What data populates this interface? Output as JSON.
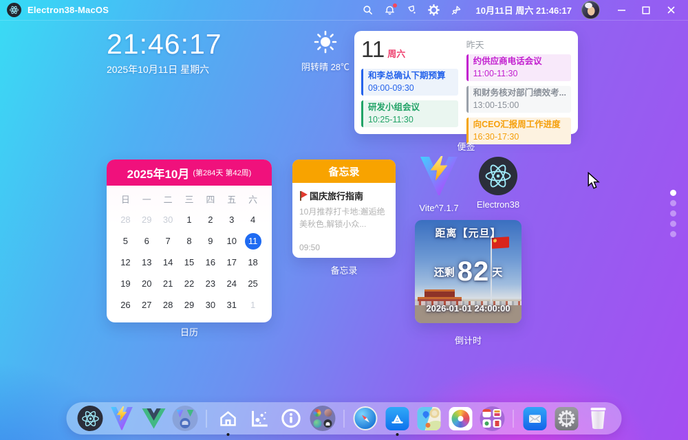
{
  "titlebar": {
    "app_title": "Electron38-MacOS",
    "datetime": "10月11日 周六 21:46:17",
    "icons": [
      "search",
      "notifications",
      "theme-bucket",
      "settings",
      "pin"
    ],
    "window_controls": [
      "minimize",
      "maximize",
      "close"
    ]
  },
  "clock": {
    "time": "21:46:17",
    "date": "2025年10月11日 星期六"
  },
  "weather": {
    "condition": "阴转晴 28℃",
    "icon": "sun"
  },
  "sticky": {
    "label": "便签",
    "day": "11",
    "weekday": "周六",
    "yesterday_label": "昨天",
    "today_events": [
      {
        "title": "和李总确认下期预算",
        "time": "09:00-09:30",
        "color": "blue"
      },
      {
        "title": "研发小组会议",
        "time": "10:25-11:30",
        "color": "green"
      }
    ],
    "yesterday_events": [
      {
        "title": "约供应商电话会议",
        "time": "11:00-11:30",
        "color": "magenta"
      },
      {
        "title": "和财务核对部门绩效考...",
        "time": "13:00-15:00",
        "color": "gray"
      },
      {
        "title": "向CEO汇报周工作进度",
        "time": "16:30-17:30",
        "color": "orange"
      }
    ]
  },
  "calendar": {
    "label": "日历",
    "title": "2025年10月",
    "subtitle": "(第284天 第42周)",
    "weekdays": [
      "日",
      "一",
      "二",
      "三",
      "四",
      "五",
      "六"
    ],
    "weeks": [
      [
        {
          "t": "28",
          "muted": true
        },
        {
          "t": "29",
          "muted": true
        },
        {
          "t": "30",
          "muted": true
        },
        {
          "t": "1"
        },
        {
          "t": "2"
        },
        {
          "t": "3"
        },
        {
          "t": "4"
        }
      ],
      [
        {
          "t": "5"
        },
        {
          "t": "6"
        },
        {
          "t": "7"
        },
        {
          "t": "8"
        },
        {
          "t": "9"
        },
        {
          "t": "10"
        },
        {
          "t": "11",
          "selected": true
        }
      ],
      [
        {
          "t": "12"
        },
        {
          "t": "13"
        },
        {
          "t": "14"
        },
        {
          "t": "15"
        },
        {
          "t": "16"
        },
        {
          "t": "17"
        },
        {
          "t": "18"
        }
      ],
      [
        {
          "t": "19"
        },
        {
          "t": "20"
        },
        {
          "t": "21"
        },
        {
          "t": "22"
        },
        {
          "t": "23"
        },
        {
          "t": "24"
        },
        {
          "t": "25"
        }
      ],
      [
        {
          "t": "26"
        },
        {
          "t": "27"
        },
        {
          "t": "28"
        },
        {
          "t": "29"
        },
        {
          "t": "30"
        },
        {
          "t": "31"
        },
        {
          "t": "1",
          "muted": true
        }
      ]
    ],
    "selected_day": "11"
  },
  "memo": {
    "label": "备忘录",
    "header": "备忘录",
    "title": "国庆旅行指南",
    "body": "10月推荐打卡地:邂逅绝美秋色,解锁小众...",
    "time": "09:50"
  },
  "apps": {
    "vite": {
      "label": "Vite^7.1.7"
    },
    "electron": {
      "label": "Electron38"
    }
  },
  "countdown": {
    "label": "倒计时",
    "title": "距离【元旦】",
    "prefix": "还剩",
    "days": "82",
    "suffix": "天",
    "target": "2026-01-01 24:00:00"
  },
  "pagination": {
    "total": 5,
    "active_index": 0
  },
  "dock": {
    "apps": [
      "electron",
      "vite",
      "vue",
      "dev-group",
      "home",
      "chart",
      "info",
      "web-group",
      "safari",
      "app-store",
      "maps",
      "photos",
      "widgets",
      "mail",
      "settings",
      "trash"
    ],
    "running": [
      "home",
      "app-store"
    ]
  },
  "colors": {
    "calendar_header": "#F0117C",
    "memo_header": "#F8A300",
    "selected_day": "#1F6BF2",
    "accent_cyan": "#39DCF4",
    "accent_purple": "#A44EF1"
  }
}
